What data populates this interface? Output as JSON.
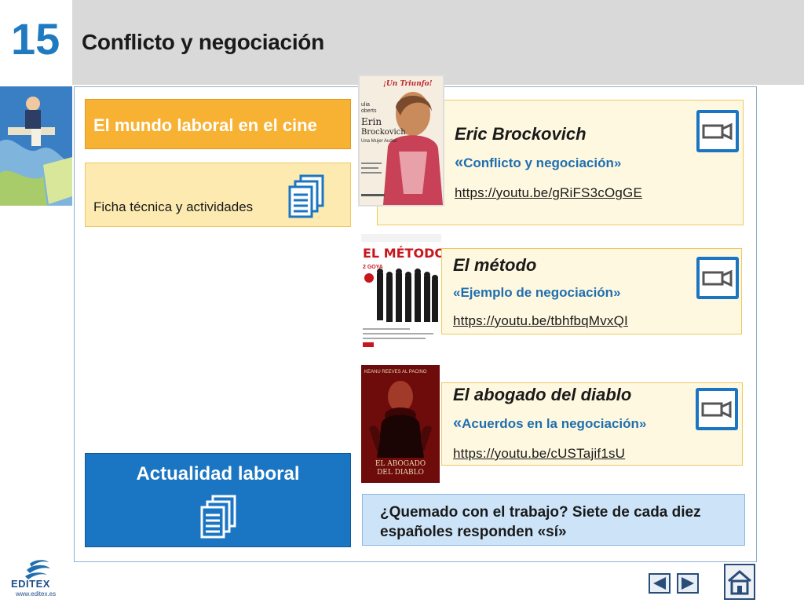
{
  "header": {
    "unit_number": "15",
    "title": "Conflicto y negociación"
  },
  "left": {
    "cine_banner": "El mundo laboral en el cine",
    "ficha_label": "Ficha técnica y actividades",
    "actualidad_label": "Actualidad laboral"
  },
  "films": [
    {
      "title": "Eric Brockovich",
      "quote_open": "«",
      "subtitle": "Conflicto y negociación»",
      "link": "https://youtu.be/gRiFS3cOgGE",
      "icon": "video-camera-icon"
    },
    {
      "title": "El método",
      "quote_open": "«",
      "subtitle": "Ejemplo de negociación»",
      "link": "https://youtu.be/tbhfbqMvxQI",
      "icon": "video-camera-icon"
    },
    {
      "title": "El abogado del diablo",
      "quote_open": "«",
      "subtitle": "Acuerdos en la negociación»",
      "link": "https://youtu.be/cUSTajif1sU",
      "icon": "video-camera-icon"
    }
  ],
  "posters": {
    "brockovich_tagline": "¡Un Triunfo!",
    "brockovich_lines": [
      "ulia",
      "oberts",
      "Erin",
      "Brockovich",
      "Una Mujer Audaz"
    ],
    "metodo_title": "EL MÉTODO",
    "metodo_award": "2 GOYA",
    "diablo_top": "KEANU REEVES  AL PACINO",
    "diablo_title_1": "EL ABOGADO",
    "diablo_title_2": "DEL DIABLO"
  },
  "news": {
    "text": "¿Quemado con el trabajo? Siete de cada diez españoles responden «sí»"
  },
  "footer": {
    "brand_name": "EDITEX",
    "brand_url": "www.editex.es"
  },
  "colors": {
    "accent_blue": "#1a75c2",
    "banner_orange": "#f7b233",
    "card_yellow": "#fdeab0",
    "news_blue": "#cde4f8"
  }
}
